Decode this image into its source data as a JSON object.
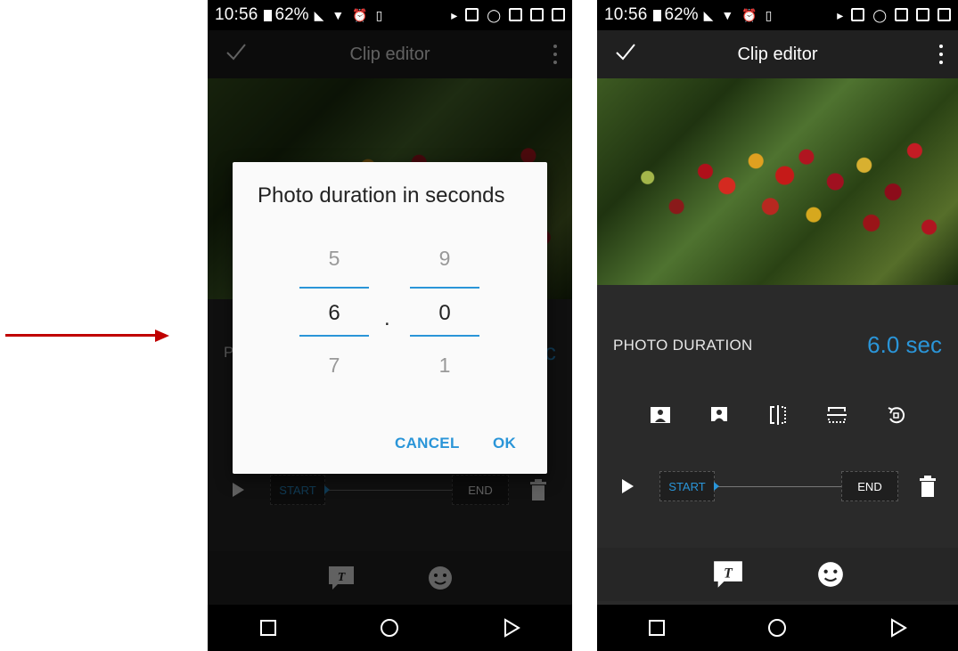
{
  "status_bar": {
    "time": "10:56",
    "battery": "62%"
  },
  "app_bar": {
    "title": "Clip editor"
  },
  "dialog": {
    "title": "Photo duration in seconds",
    "seconds": {
      "above": "5",
      "selected": "6",
      "below": "7"
    },
    "separator": ".",
    "tenths": {
      "above": "9",
      "selected": "0",
      "below": "1"
    },
    "cancel_label": "CANCEL",
    "ok_label": "OK"
  },
  "editor": {
    "duration_label": "PHOTO DURATION",
    "duration_value": "6.0 sec",
    "trim_start_label": "START",
    "trim_end_label": "END",
    "partial_label_left": "P",
    "partial_value_left": "c"
  },
  "colors": {
    "accent": "#2a95d8",
    "arrow": "#c00000",
    "background": "#2a2a2a"
  }
}
